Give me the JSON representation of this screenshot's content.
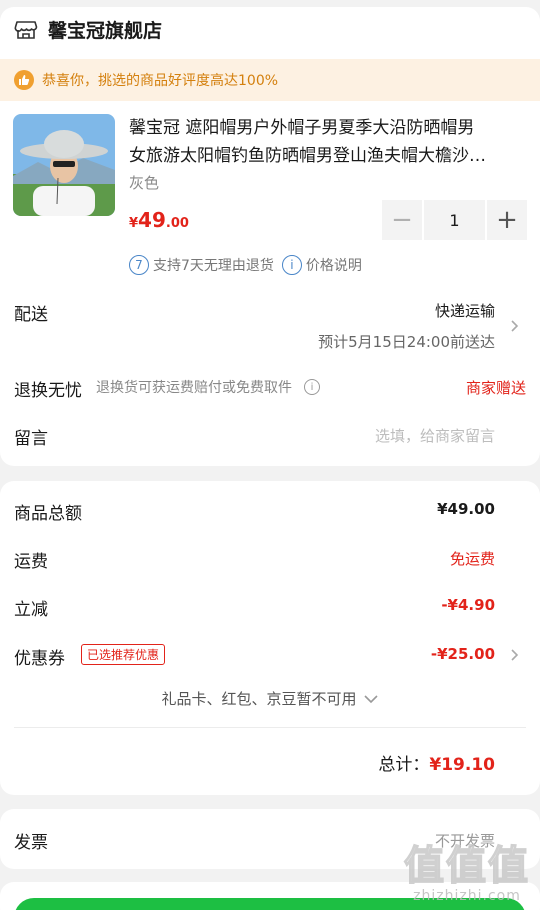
{
  "shop": {
    "name": "馨宝冠旗舰店"
  },
  "banner": {
    "text": "恭喜你，挑选的商品好评度高达100%"
  },
  "product": {
    "title_line1": "馨宝冠 遮阳帽男户外帽子男夏季大沿防晒帽男",
    "title_line2": "女旅游太阳帽钓鱼防晒帽男登山渔夫帽大檐沙…",
    "spec": "灰色",
    "price_currency": "¥",
    "price_int": "49",
    "price_dec": ".00",
    "quantity": "1",
    "minus": "−",
    "plus": "+"
  },
  "services": {
    "return_badge": "7",
    "return_text": "支持7天无理由退货",
    "price_badge": "i",
    "price_text": "价格说明"
  },
  "delivery": {
    "label": "配送",
    "method": "快递运输",
    "eta": "预计5月15日24:00前送达"
  },
  "returns": {
    "label": "退换无忧",
    "desc": "退换货可获运费赔付或免费取件",
    "info_badge": "i",
    "gift": "商家赠送"
  },
  "message": {
    "label": "留言",
    "placeholder": "选填，给商家留言"
  },
  "summary": {
    "goods_label": "商品总额",
    "goods_value": "¥49.00",
    "shipping_label": "运费",
    "shipping_value": "免运费",
    "discount_label": "立减",
    "discount_value": "-¥4.90",
    "coupon_label": "优惠券",
    "coupon_tag": "已选推荐优惠",
    "coupon_value": "-¥25.00",
    "unavailable": "礼品卡、红包、京豆暂不可用",
    "total_label": "总计：",
    "total_value": "¥19.10"
  },
  "invoice": {
    "label": "发票",
    "value": "不开发票"
  },
  "watermark": {
    "big": "值值值",
    "small": "zhizhizhi.com"
  },
  "colors": {
    "accent_red": "#e2231a",
    "banner_orange": "#d4800e",
    "submit_green": "#1dbf43"
  }
}
